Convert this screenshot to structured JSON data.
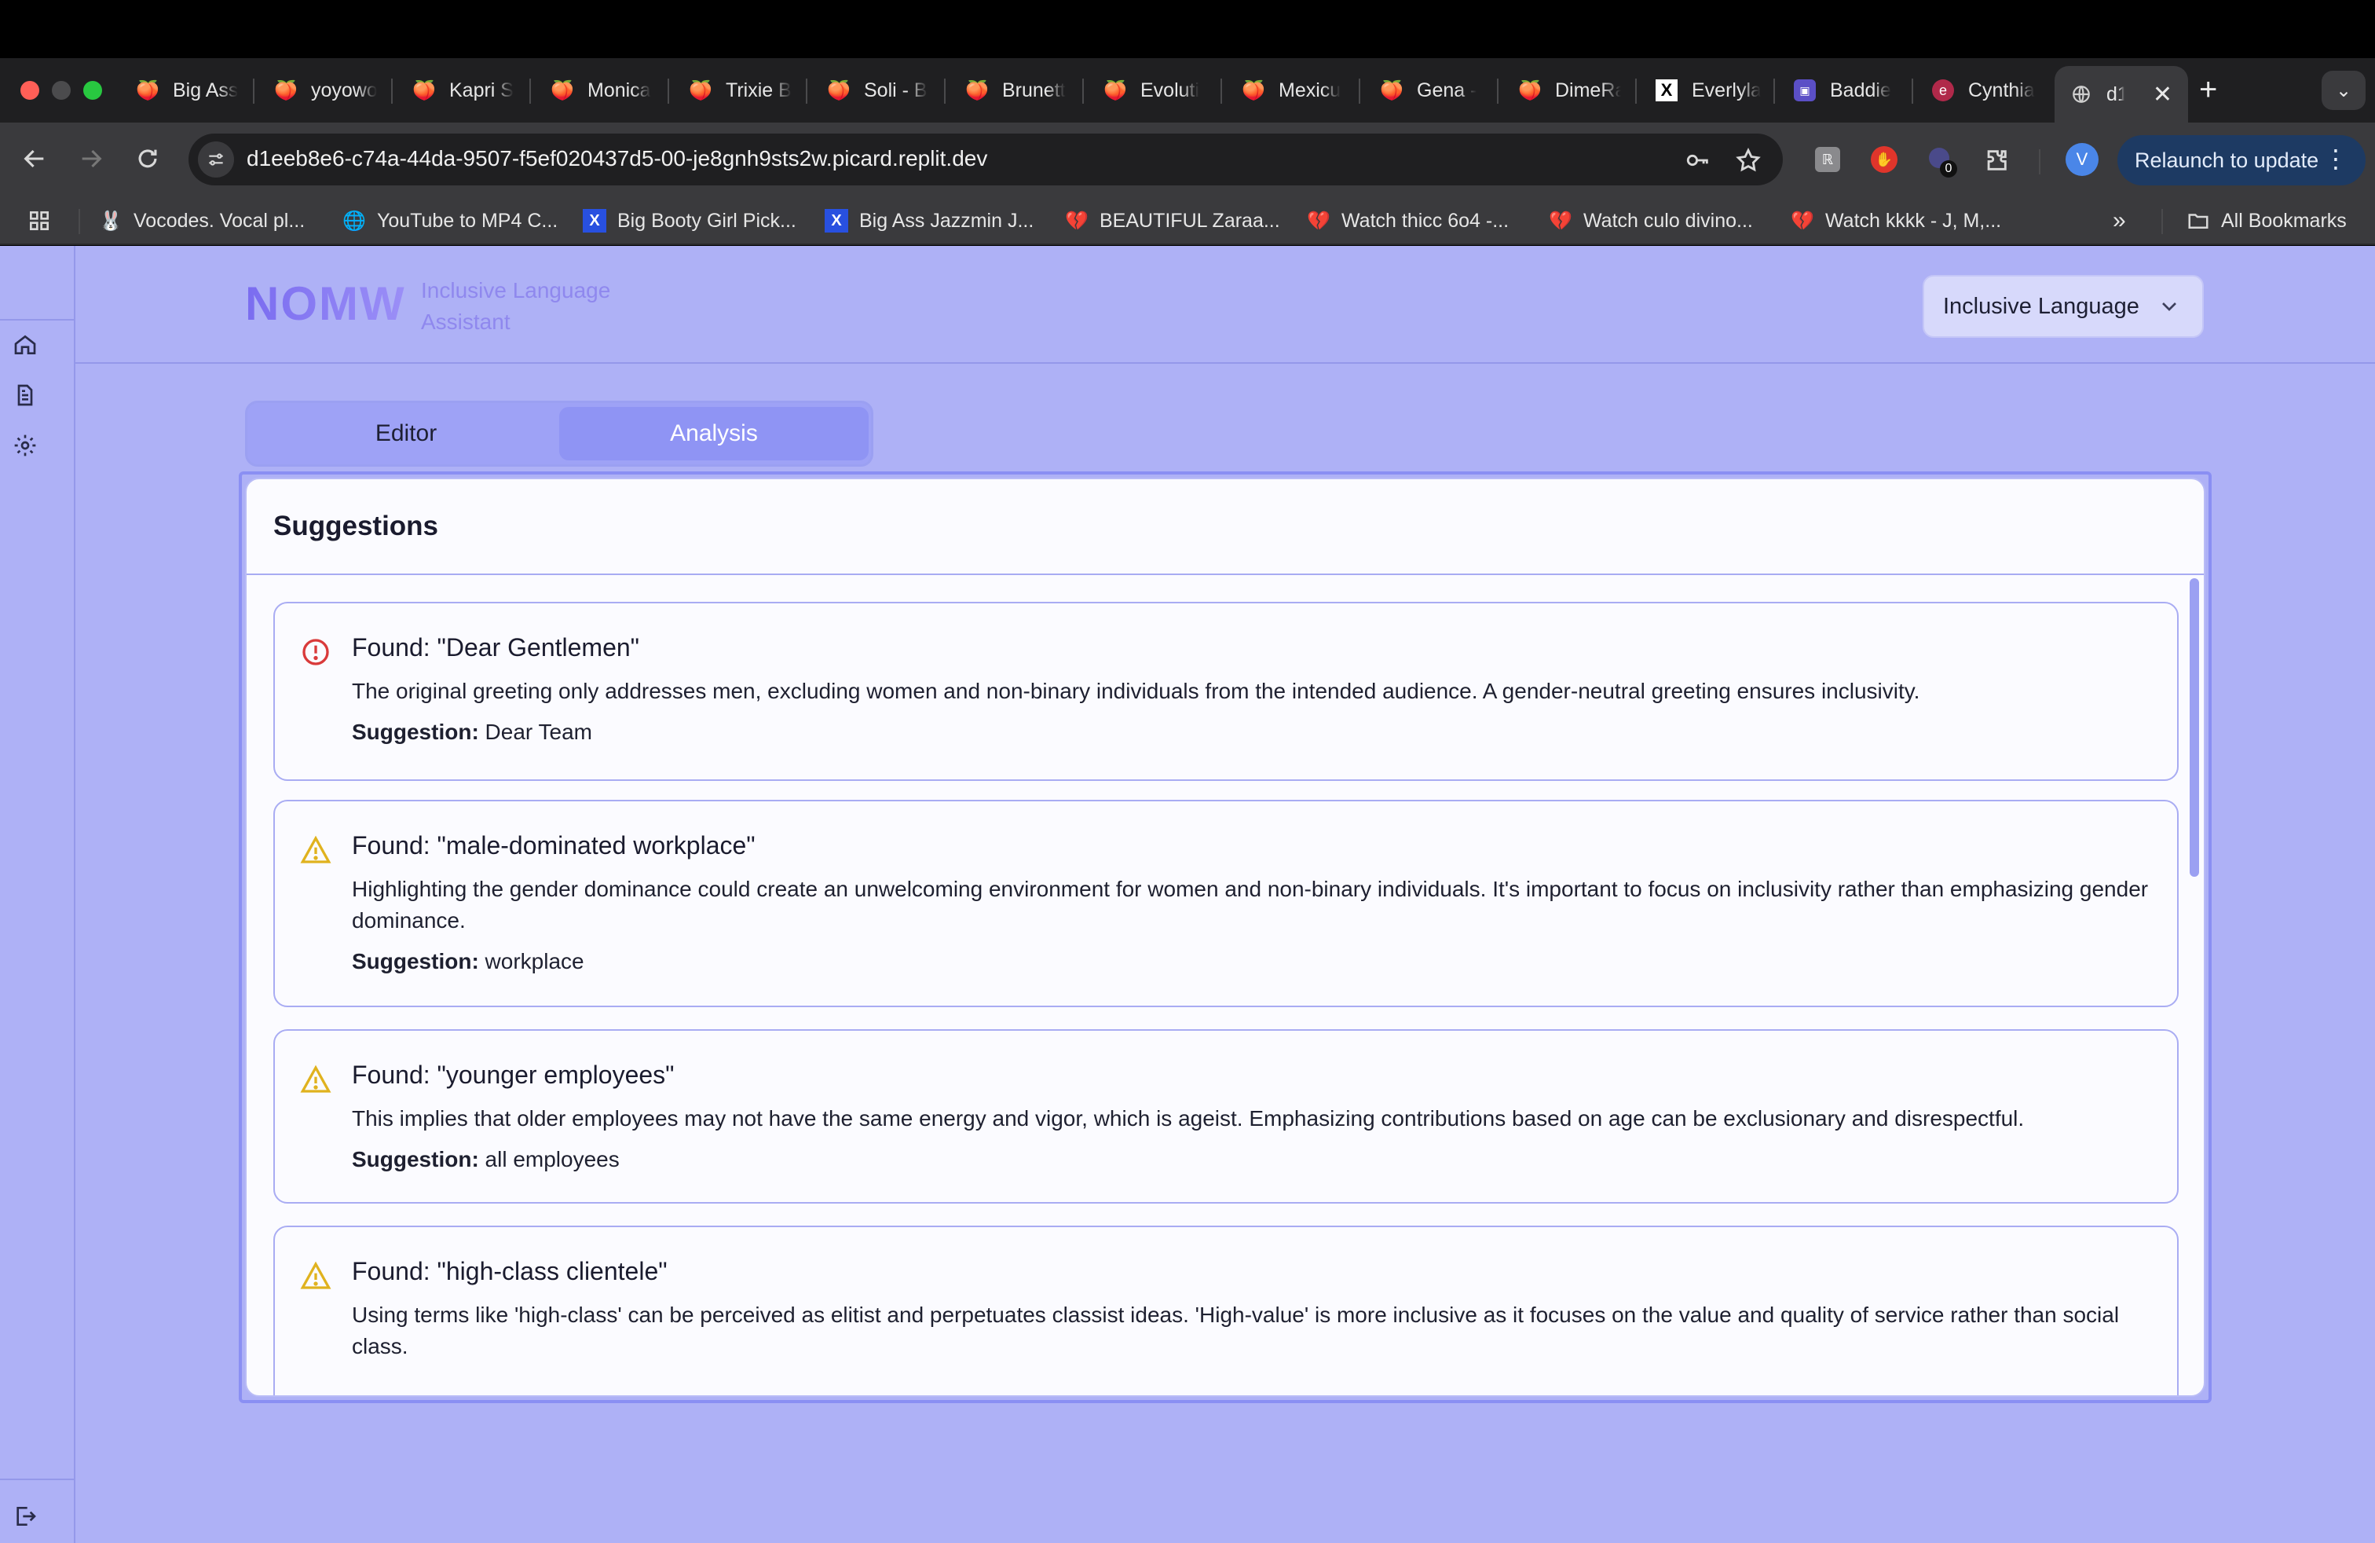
{
  "browser": {
    "tabs": [
      {
        "title": "Big Ass"
      },
      {
        "title": "yoyowo"
      },
      {
        "title": "Kapri S"
      },
      {
        "title": "Monica"
      },
      {
        "title": "Trixie B"
      },
      {
        "title": "Soli - B"
      },
      {
        "title": "Brunett"
      },
      {
        "title": "Evoluti"
      },
      {
        "title": "Mexicu"
      },
      {
        "title": "Gena -"
      },
      {
        "title": "DimeRa"
      },
      {
        "title": "Everlyla"
      },
      {
        "title": "Baddie"
      },
      {
        "title": "Cynthia"
      },
      {
        "title": "d1e"
      }
    ],
    "url": "d1eeb8e6-c74a-44da-9507-f5ef020437d5-00-je8gnh9sts2w.picard.replit.dev",
    "extension_badge": "0",
    "profile_initial": "V",
    "relaunch_label": "Relaunch to update",
    "bookmarks": [
      {
        "label": "Vocodes. Vocal pl..."
      },
      {
        "label": "YouTube to MP4 C..."
      },
      {
        "label": "Big Booty Girl Pick..."
      },
      {
        "label": "Big Ass Jazzmin J..."
      },
      {
        "label": "BEAUTIFUL Zaraa..."
      },
      {
        "label": "Watch thicc 6o4 -..."
      },
      {
        "label": "Watch culo divino..."
      },
      {
        "label": "Watch kkkk - J, M,..."
      }
    ],
    "bookmarks_overflow": "»",
    "all_bookmarks_label": "All Bookmarks"
  },
  "app": {
    "logo": "NOMW",
    "logo_subtitle_line1": "Inclusive Language",
    "logo_subtitle_line2": "Assistant",
    "mode_select": "Inclusive Language",
    "tabs": {
      "editor": "Editor",
      "analysis": "Analysis"
    },
    "active_tab": "Analysis",
    "panel_title": "Suggestions",
    "suggestion_prefix": "Suggestion:",
    "cards": [
      {
        "severity": "error",
        "found": "Found: \"Dear Gentlemen\"",
        "description": "The original greeting only addresses men, excluding women and non-binary individuals from the intended audience. A gender-neutral greeting ensures inclusivity.",
        "suggestion": "Dear Team"
      },
      {
        "severity": "warning",
        "found": "Found: \"male-dominated workplace\"",
        "description": "Highlighting the gender dominance could create an unwelcoming environment for women and non-binary individuals. It's important to focus on inclusivity rather than emphasizing gender dominance.",
        "suggestion": "workplace"
      },
      {
        "severity": "warning",
        "found": "Found: \"younger employees\"",
        "description": "This implies that older employees may not have the same energy and vigor, which is ageist. Emphasizing contributions based on age can be exclusionary and disrespectful.",
        "suggestion": "all employees"
      },
      {
        "severity": "warning",
        "found": "Found: \"high-class clientele\"",
        "description": "Using terms like 'high-class' can be perceived as elitist and perpetuates classist ideas. 'High-value' is more inclusive as it focuses on the value and quality of service rather than social class.",
        "suggestion": ""
      }
    ]
  },
  "colors": {
    "app_bg": "#aeb1f6",
    "accent": "#8f94f4",
    "error": "#d93a3a",
    "warning": "#e0b21e"
  }
}
